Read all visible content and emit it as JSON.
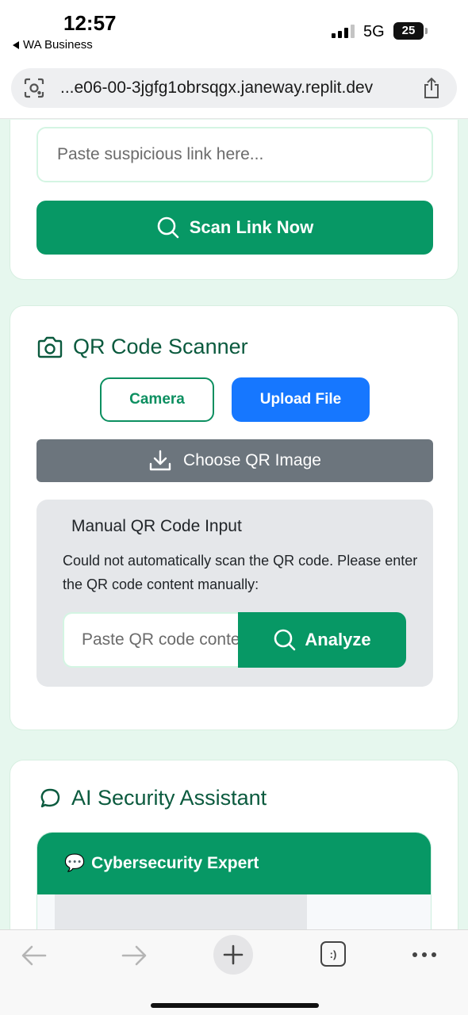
{
  "status_bar": {
    "time": "12:57",
    "back_app": "WA Business",
    "network": "5G",
    "battery": "25"
  },
  "browser": {
    "url": "...e06-00-3jgfg1obrsqgx.janeway.replit.dev"
  },
  "link_scanner": {
    "input_placeholder": "Paste suspicious link here...",
    "scan_button": "Scan Link Now"
  },
  "qr_scanner": {
    "title": "QR Code Scanner",
    "camera_button": "Camera",
    "upload_button": "Upload File",
    "choose_button": "Choose QR Image",
    "manual": {
      "title": "Manual QR Code Input",
      "description": "Could not automatically scan the QR code. Please enter the QR code content manually:",
      "input_placeholder": "Paste QR code content",
      "analyze_button": "Analyze"
    }
  },
  "ai_assistant": {
    "title": "AI Security Assistant",
    "chat_header": "Cybersecurity Expert",
    "chat_header_emoji": "💬"
  },
  "colors": {
    "primary_green": "#079865",
    "upload_blue": "#1677ff",
    "choose_gray": "#6c757d",
    "title_green": "#0b5a3e"
  }
}
